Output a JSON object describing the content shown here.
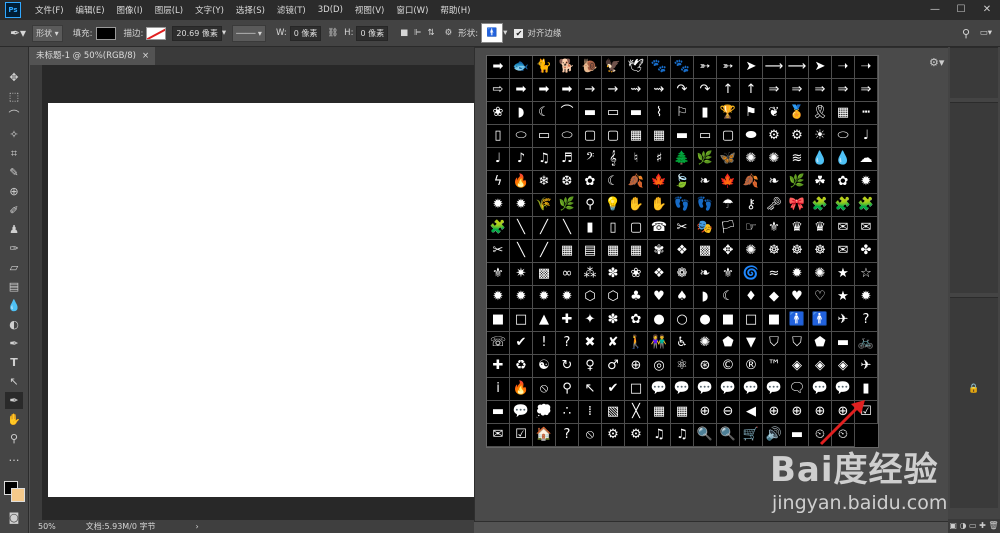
{
  "app": {
    "logo": "Ps"
  },
  "menubar": {
    "items": [
      "文件(F)",
      "编辑(E)",
      "图像(I)",
      "图层(L)",
      "文字(Y)",
      "选择(S)",
      "滤镜(T)",
      "3D(D)",
      "视图(V)",
      "窗口(W)",
      "帮助(H)"
    ]
  },
  "window_controls": {
    "minimize": "—",
    "maximize": "☐",
    "close": "✕"
  },
  "options": {
    "mode_value": "形状",
    "fill_label": "填充:",
    "stroke_label": "描边:",
    "stroke_width": "20.69 像素",
    "w_label": "W:",
    "w_value": "0 像素",
    "h_label": "H:",
    "h_value": "0 像素",
    "shape_label": "形状:",
    "align_edges_label": "对齐边缘"
  },
  "document": {
    "tab_title": "未标题-1 @ 50%(RGB/8)",
    "tab_close": "×"
  },
  "statusbar": {
    "zoom": "50%",
    "doc_info": "文档:5.93M/0 字节",
    "arrow": "›"
  },
  "shapes": [
    "➡",
    "🐟",
    "🐈",
    "🐕",
    "🐌",
    "🦅",
    "🕊",
    "🐾",
    "🐾",
    "➳",
    "➳",
    "➤",
    "⟶",
    "⟶",
    "➤",
    "➝",
    "➝",
    "⇨",
    "➡",
    "➡",
    "➡",
    "→",
    "→",
    "⇝",
    "⇝",
    "↷",
    "↷",
    "↑",
    "↑",
    "⇒",
    "⇒",
    "⇒",
    "⇒",
    "⇒",
    "❀",
    "◗",
    "☾",
    "⌒",
    "▬",
    "▭",
    "▬",
    "⌇",
    "⚐",
    "▮",
    "🏆",
    "⚑",
    "❦",
    "🏅",
    "🎗",
    "▦",
    "┅",
    "▯",
    "⬭",
    "▭",
    "⬭",
    "▢",
    "▢",
    "▦",
    "▦",
    "▬",
    "▭",
    "▢",
    "⬬",
    "⚙",
    "⚙",
    "☀",
    "⬭",
    "♩",
    "♩",
    "♪",
    "♫",
    "♬",
    "𝄢",
    "𝄞",
    "♮",
    "♯",
    "🌲",
    "🌿",
    "🦋",
    "✺",
    "✺",
    "≋",
    "💧",
    "💧",
    "☁",
    "ϟ",
    "🔥",
    "❄",
    "❆",
    "✿",
    "☾",
    "🍂",
    "🍁",
    "🍃",
    "❧",
    "🍁",
    "🍂",
    "❧",
    "🌿",
    "☘",
    "✿",
    "✹",
    "✹",
    "✹",
    "🌾",
    "🌿",
    "⚲",
    "💡",
    "✋",
    "✋",
    "👣",
    "👣",
    "☂",
    "⚷",
    "🗝",
    "🎀",
    "🧩",
    "🧩",
    "🧩",
    "🧩",
    "╲",
    "╱",
    "╲",
    "▮",
    "▯",
    "▢",
    "☎",
    "✂",
    "🎭",
    "🏳",
    "☞",
    "⚜",
    "♛",
    "♛",
    "✉",
    "✉",
    "✂",
    "╲",
    "╱",
    "▦",
    "▤",
    "▦",
    "▦",
    "✾",
    "❖",
    "▩",
    "✥",
    "✺",
    "☸",
    "☸",
    "☸",
    "✉",
    "✤",
    "⚜",
    "✷",
    "▩",
    "∞",
    "⁂",
    "✽",
    "❀",
    "❖",
    "❁",
    "❧",
    "⚜",
    "🌀",
    "≈",
    "✹",
    "✺",
    "★",
    "☆",
    "✹",
    "✹",
    "✹",
    "✹",
    "⬡",
    "⬡",
    "♣",
    "♥",
    "♠",
    "◗",
    "☾",
    "♦",
    "◆",
    "♥",
    "♡",
    "★",
    "✹",
    "■",
    "□",
    "▲",
    "✚",
    "✦",
    "✽",
    "✿",
    "●",
    "○",
    "●",
    "■",
    "□",
    "■",
    "🚹",
    "🚹",
    "✈",
    "?",
    "☏",
    "✔",
    "!",
    "?",
    "✖",
    "✘",
    "🚶",
    "👫",
    "♿",
    "✺",
    "⬟",
    "▼",
    "⛉",
    "⛉",
    "⬟",
    "▬",
    "🚲",
    "✚",
    "♻",
    "☯",
    "↻",
    "♀",
    "♂",
    "⊕",
    "◎",
    "⚛",
    "⊛",
    "©",
    "®",
    "™",
    "◈",
    "◈",
    "◈",
    "✈",
    "i",
    "🔥",
    "⦸",
    "⚲",
    "↖",
    "✔",
    "□",
    "💬",
    "💬",
    "💬",
    "💬",
    "💬",
    "💬",
    "🗨",
    "💬",
    "💬",
    "▮",
    "▬",
    "💬",
    "💭",
    "∴",
    "⁞",
    "▧",
    "╳",
    "▦",
    "▦",
    "⊕",
    "⊖",
    "◀",
    "⊕",
    "⊕",
    "⊕",
    "⊕",
    "☑",
    "✉",
    "☑",
    "🏠",
    "?",
    "⦸",
    "⚙",
    "⚙",
    "♫",
    "♫",
    "🔍",
    "🔍",
    "🛒",
    "🔊",
    "▬",
    "⏲",
    "⏲"
  ],
  "watermark": {
    "logo": "Bai度经验",
    "url": "jingyan.baidu.com"
  },
  "colors": {
    "accent": "#31a8ff",
    "arrow": "#e02020"
  }
}
